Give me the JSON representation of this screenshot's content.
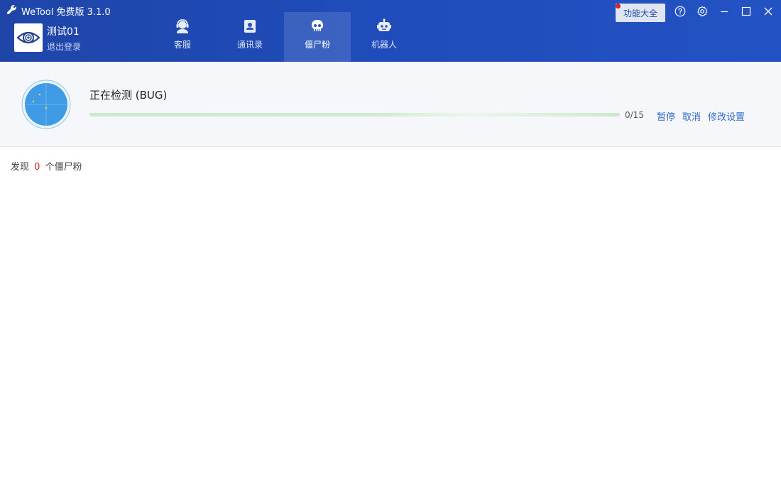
{
  "app": {
    "title": "WeTool 免费版 3.1.0"
  },
  "user": {
    "name": "测试01",
    "logout_label": "退出登录"
  },
  "nav": {
    "tabs": [
      {
        "label": "客服",
        "icon": "customer-service-icon",
        "active": false
      },
      {
        "label": "通讯录",
        "icon": "contacts-icon",
        "active": false
      },
      {
        "label": "僵尸粉",
        "icon": "skull-icon",
        "active": true
      },
      {
        "label": "机器人",
        "icon": "robot-icon",
        "active": false
      }
    ]
  },
  "toolbar": {
    "features_label": "功能大全"
  },
  "colors": {
    "header": "#1f45a8",
    "accent_link": "#2f6bd0",
    "count_red": "#e02020",
    "progress_green": "#5cbf5c"
  },
  "scan": {
    "title": "正在检测 (BUG)",
    "progress_text": "0/15",
    "progress_fraction": 0,
    "actions": {
      "pause": "暂停",
      "cancel": "取消",
      "settings": "修改设置"
    }
  },
  "result": {
    "prefix": "发现",
    "count": "0",
    "suffix": "个僵尸粉"
  }
}
